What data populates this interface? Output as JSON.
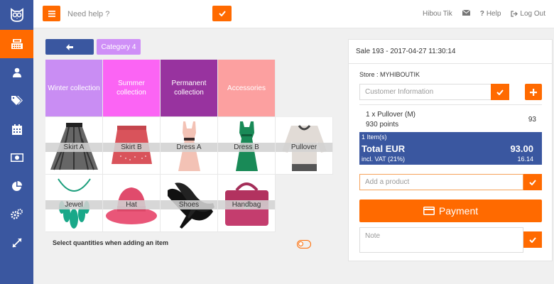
{
  "colors": {
    "accent": "#ff6a00",
    "sidebar": "#3a57a0",
    "winter": "#c98df3",
    "summer": "#fb64f4",
    "permanent": "#98339f",
    "accessories": "#fca0a0"
  },
  "sidebar": {
    "logo": "owl-logo-icon",
    "items": [
      {
        "icon": "cash-register-icon",
        "active": true
      },
      {
        "icon": "user-icon"
      },
      {
        "icon": "tags-icon"
      },
      {
        "icon": "calendar-icon"
      },
      {
        "icon": "money-icon"
      },
      {
        "icon": "pie-chart-icon"
      },
      {
        "icon": "cogs-icon"
      },
      {
        "icon": "expand-icon"
      }
    ]
  },
  "topbar": {
    "help_placeholder": "Need help ?",
    "username": "Hibou Tik",
    "help_label": "Help",
    "logout_label": "Log Out"
  },
  "category_bar": {
    "current": "Category 4"
  },
  "categories": [
    {
      "label": "Winter collection",
      "color": "#c98df3"
    },
    {
      "label": "Summer collection",
      "color": "#fb64f4"
    },
    {
      "label": "Permanent collection",
      "color": "#98339f"
    },
    {
      "label": "Accessories",
      "color": "#fca0a0"
    }
  ],
  "products_row1": [
    {
      "label": "Skirt A",
      "icon": "skirt-a-image"
    },
    {
      "label": "Skirt B",
      "icon": "skirt-b-image"
    },
    {
      "label": "Dress A",
      "icon": "dress-a-image"
    },
    {
      "label": "Dress B",
      "icon": "dress-b-image"
    },
    {
      "label": "Pullover",
      "icon": "pullover-image"
    }
  ],
  "products_row2": [
    {
      "label": "Jewel",
      "icon": "jewel-image"
    },
    {
      "label": "Hat",
      "icon": "hat-image"
    },
    {
      "label": "Shoes",
      "icon": "shoes-image"
    },
    {
      "label": "Handbag",
      "icon": "handbag-image"
    }
  ],
  "options": {
    "select_quantities": "Select quantities when adding an item"
  },
  "sale": {
    "header": "Sale 193 - 2017-04-27 11:30:14",
    "store": "Store : MYHIBOUTIK",
    "customer_placeholder": "Customer Information",
    "line": {
      "description": "1 x Pullover (M)",
      "points": "930 points",
      "qty": "93"
    },
    "total": {
      "items": "1 Item(s)",
      "label": "Total EUR",
      "value": "93.00",
      "vat_label": "incl. VAT (21%)",
      "vat_value": "16.14"
    },
    "add_product_placeholder": "Add a product",
    "payment_label": "Payment",
    "note_placeholder": "Note"
  }
}
